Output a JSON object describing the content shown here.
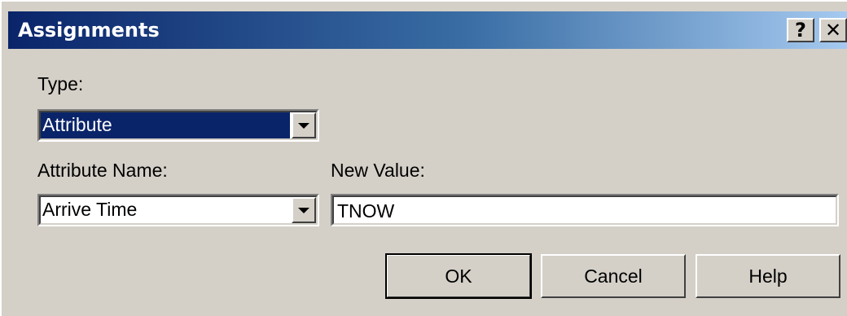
{
  "window": {
    "title": "Assignments",
    "help_glyph": "?",
    "close_glyph": "✕"
  },
  "type": {
    "label": "Type:",
    "selected": "Attribute"
  },
  "attribute_name": {
    "label": "Attribute Name:",
    "selected": "Arrive Time"
  },
  "new_value": {
    "label": "New Value:",
    "value": "TNOW"
  },
  "buttons": {
    "ok": "OK",
    "cancel": "Cancel",
    "help": "Help"
  },
  "icons": {
    "help": "help-icon",
    "close": "close-icon",
    "dropdown": "chevron-down-icon"
  },
  "colors": {
    "title_gradient_start": "#0a246a",
    "title_gradient_end": "#a6caf0",
    "dialog_bg": "#d4d0c8",
    "selection_bg": "#0a246a"
  }
}
